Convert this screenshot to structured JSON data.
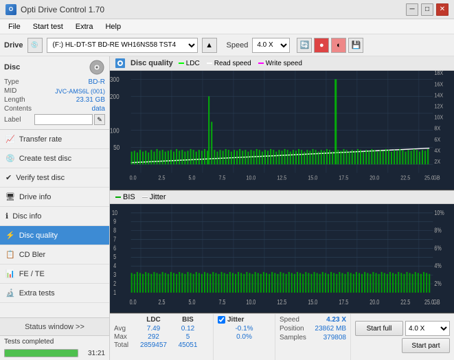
{
  "titleBar": {
    "title": "Opti Drive Control 1.70",
    "minimizeBtn": "─",
    "maximizeBtn": "□",
    "closeBtn": "✕"
  },
  "menuBar": {
    "items": [
      "File",
      "Start test",
      "Extra",
      "Help"
    ]
  },
  "driveBar": {
    "driveLabel": "Drive",
    "driveValue": "(F:) HL-DT-ST BD-RE  WH16NS58 TST4",
    "speedLabel": "Speed",
    "speedValue": "4.0 X"
  },
  "disc": {
    "header": "Disc",
    "typeLabel": "Type",
    "typeValue": "BD-R",
    "midLabel": "MID",
    "midValue": "JVC-AMS6L (001)",
    "lengthLabel": "Length",
    "lengthValue": "23.31 GB",
    "contentsLabel": "Contents",
    "contentsValue": "data",
    "labelLabel": "Label",
    "labelValue": ""
  },
  "navItems": [
    {
      "id": "transfer-rate",
      "label": "Transfer rate",
      "icon": "📈"
    },
    {
      "id": "create-test-disc",
      "label": "Create test disc",
      "icon": "💿"
    },
    {
      "id": "verify-test-disc",
      "label": "Verify test disc",
      "icon": "✔"
    },
    {
      "id": "drive-info",
      "label": "Drive info",
      "icon": "🖴"
    },
    {
      "id": "disc-info",
      "label": "Disc info",
      "icon": "ℹ"
    },
    {
      "id": "disc-quality",
      "label": "Disc quality",
      "icon": "⚡",
      "active": true
    },
    {
      "id": "cd-bler",
      "label": "CD Bler",
      "icon": "📋"
    },
    {
      "id": "fe-te",
      "label": "FE / TE",
      "icon": "📊"
    },
    {
      "id": "extra-tests",
      "label": "Extra tests",
      "icon": "🔬"
    }
  ],
  "statusBar": {
    "windowBtn": "Status window >>",
    "statusText": "Tests completed",
    "progressPercent": 100,
    "time": "31:21"
  },
  "chart": {
    "title": "Disc quality",
    "legend": {
      "ldc": "LDC",
      "readSpeed": "Read speed",
      "writeSpeed": "Write speed"
    },
    "legend2": {
      "bis": "BIS",
      "jitter": "Jitter"
    },
    "yAxis1": [
      "300",
      "200",
      "100",
      "50"
    ],
    "yAxis1Right": [
      "18X",
      "16X",
      "14X",
      "12X",
      "10X",
      "8X",
      "6X",
      "4X",
      "2X"
    ],
    "xAxis": [
      "0.0",
      "2.5",
      "5.0",
      "7.5",
      "10.0",
      "12.5",
      "15.0",
      "17.5",
      "20.0",
      "22.5",
      "25.0"
    ],
    "xAxisLabel": "GB",
    "yAxis2": [
      "10",
      "9",
      "8",
      "7",
      "6",
      "5",
      "4",
      "3",
      "2",
      "1"
    ],
    "yAxis2Right": [
      "10%",
      "8%",
      "6%",
      "4%",
      "2%"
    ]
  },
  "stats": {
    "columns": [
      "LDC",
      "BIS",
      "",
      "Jitter",
      "Speed",
      "4.23 X"
    ],
    "speedDropdown": "4.0 X",
    "rows": [
      {
        "label": "Avg",
        "ldc": "7.49",
        "bis": "0.12",
        "jitter": "-0.1%"
      },
      {
        "label": "Max",
        "ldc": "292",
        "bis": "5",
        "jitter": "0.0%"
      },
      {
        "label": "Total",
        "ldc": "2859457",
        "bis": "45051",
        "jitter": ""
      }
    ],
    "jitterChecked": true,
    "position": {
      "label": "Position",
      "value": "23862 MB"
    },
    "samples": {
      "label": "Samples",
      "value": "379808"
    },
    "startFull": "Start full",
    "startPart": "Start part"
  }
}
